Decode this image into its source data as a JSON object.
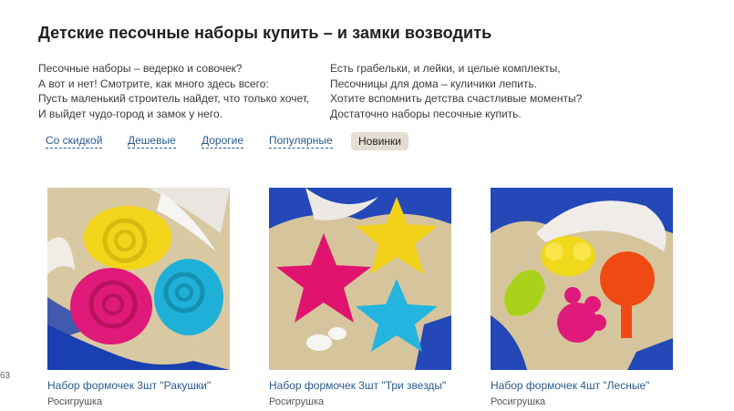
{
  "header": {
    "title": "Детские песочные наборы купить – и замки возводить"
  },
  "intro": {
    "left_lines": [
      "Песочные наборы – ведерко и совочек?",
      "А вот и нет! Смотрите, как много здесь всего:",
      "Пусть маленький строитель найдет, что только хочет,",
      "И выйдет чудо-город и замок у него."
    ],
    "right_lines": [
      "Есть грабельки, и лейки, и целые комплекты,",
      "Песочницы для дома – куличики лепить.",
      "Хотите вспомнить детства счастливые моменты?",
      "Достаточно наборы песочные купить."
    ]
  },
  "filters": [
    {
      "label": "Со скидкой",
      "active": false
    },
    {
      "label": "Дешевые",
      "active": false
    },
    {
      "label": "Дорогие",
      "active": false
    },
    {
      "label": "Популярные",
      "active": false
    },
    {
      "label": "Новинки",
      "active": true
    }
  ],
  "products": [
    {
      "name": "Набор формочек 3шт \"Ракушки\"",
      "brand": "Росигрушка",
      "image": "shells-molds-photo"
    },
    {
      "name": "Набор формочек 3шт \"Три звезды\"",
      "brand": "Росигрушка",
      "image": "stars-molds-photo"
    },
    {
      "name": "Набор формочек 4шт \"Лесные\"",
      "brand": "Росигрушка",
      "image": "forest-molds-photo"
    }
  ],
  "edge_text": "63",
  "colors": {
    "link": "#2a5a8c",
    "active_filter_bg": "#e5ddd3",
    "sand": "#d9c9a3",
    "sea": "#1a3fb0"
  }
}
